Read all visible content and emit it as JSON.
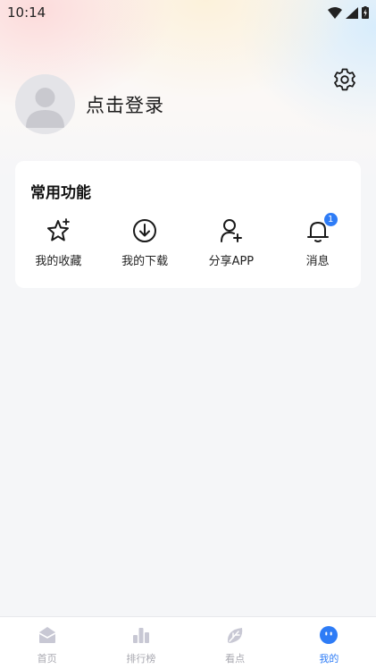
{
  "status_bar": {
    "time": "10:14"
  },
  "profile": {
    "login_text": "点击登录"
  },
  "common_functions": {
    "title": "常用功能",
    "items": [
      {
        "label": "我的收藏",
        "icon": "star-icon"
      },
      {
        "label": "我的下载",
        "icon": "download-icon"
      },
      {
        "label": "分享APP",
        "icon": "add-user-icon"
      },
      {
        "label": "消息",
        "icon": "bell-icon",
        "badge": "1"
      }
    ]
  },
  "tab_bar": {
    "items": [
      {
        "label": "首页",
        "icon": "home-icon",
        "active": false
      },
      {
        "label": "排行榜",
        "icon": "ranking-icon",
        "active": false
      },
      {
        "label": "看点",
        "icon": "leaf-icon",
        "active": false
      },
      {
        "label": "我的",
        "icon": "profile-face-icon",
        "active": true
      }
    ]
  },
  "colors": {
    "accent": "#2e7cf6",
    "inactive": "#a8a8b0",
    "background": "#f5f6f8"
  }
}
